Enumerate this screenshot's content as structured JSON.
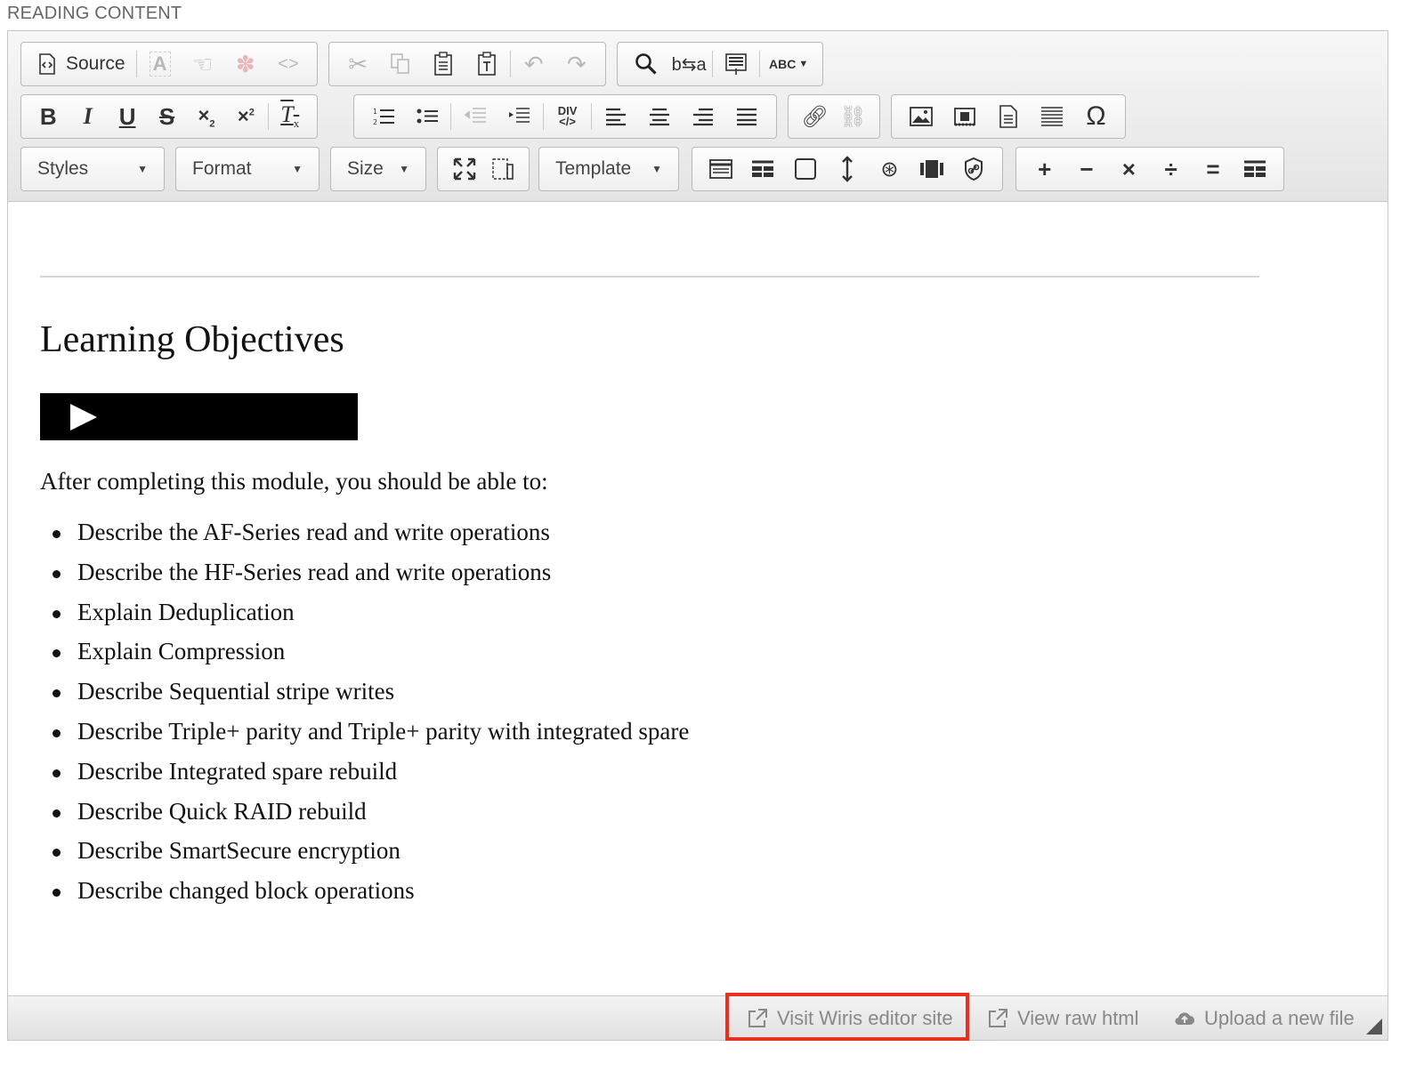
{
  "section_label": "READING CONTENT",
  "toolbar": {
    "source_label": "Source",
    "styles_label": "Styles",
    "format_label": "Format",
    "size_label": "Size",
    "template_label": "Template",
    "bold": "B",
    "italic": "I",
    "underline": "U",
    "strike": "S",
    "omega": "Ω",
    "plus": "+",
    "minus": "−",
    "times": "×",
    "divide": "÷",
    "equals": "=",
    "div_label": "DIV",
    "spell_label": "ABC"
  },
  "content": {
    "heading": "Learning Objectives",
    "intro": "After completing this module, you should be able to:",
    "objectives": [
      "Describe the AF-Series read and write operations",
      "Describe the HF-Series read and write operations",
      "Explain Deduplication",
      "Explain Compression",
      "Describe Sequential stripe writes",
      "Describe Triple+ parity and Triple+ parity with integrated spare",
      "Describe Integrated spare rebuild",
      "Describe Quick RAID rebuild",
      "Describe SmartSecure encryption",
      "Describe changed block operations"
    ]
  },
  "footer": {
    "wiris_label": "Visit Wiris editor site",
    "raw_label": "View raw html",
    "upload_label": "Upload a new file"
  },
  "colors": {
    "highlight": "#e8301c",
    "toolbar_bg": "#ececec",
    "disabled_icon": "#b8b8b8"
  }
}
